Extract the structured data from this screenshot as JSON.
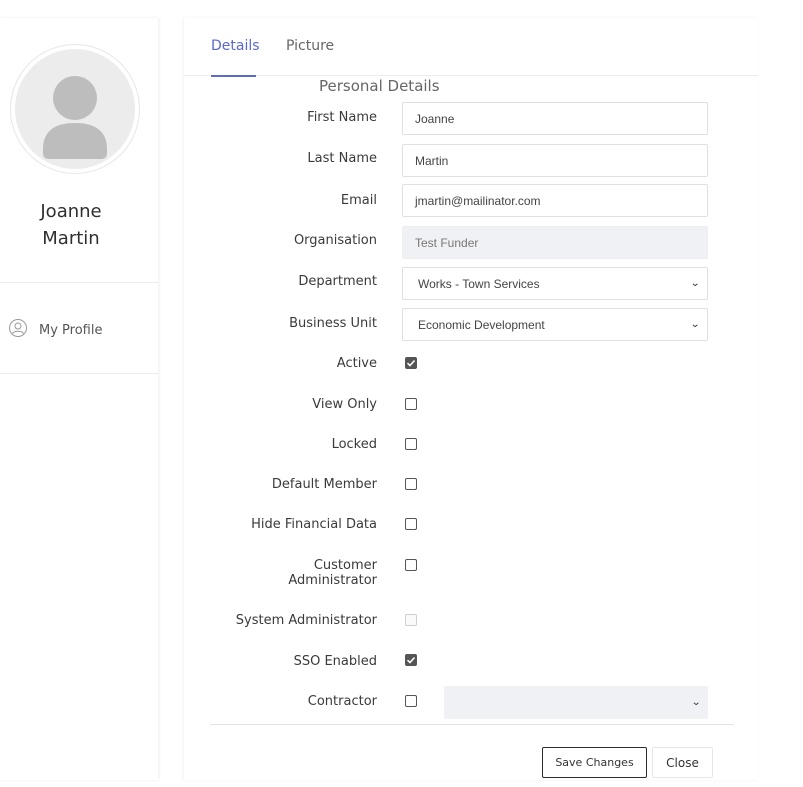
{
  "profile": {
    "name_line1": "Joanne",
    "name_line2": "Martin",
    "avatar_icon": "user-silhouette-icon",
    "menu": [
      {
        "label": "My Profile",
        "icon": "profile-icon"
      }
    ]
  },
  "tabs": [
    {
      "label": "Details",
      "active": true
    },
    {
      "label": "Picture",
      "active": false
    }
  ],
  "form": {
    "section_title": "Personal Details",
    "first_name": {
      "label": "First Name",
      "value": "Joanne"
    },
    "last_name": {
      "label": "Last Name",
      "value": "Martin"
    },
    "email": {
      "label": "Email",
      "value": "jmartin@mailinator.com"
    },
    "organisation": {
      "label": "Organisation",
      "value": "Test Funder"
    },
    "department": {
      "label": "Department",
      "value": "Works - Town Services"
    },
    "business_unit": {
      "label": "Business Unit",
      "value": "Economic Development"
    },
    "checkboxes": {
      "active": {
        "label": "Active",
        "checked": true
      },
      "view_only": {
        "label": "View Only",
        "checked": false
      },
      "locked": {
        "label": "Locked",
        "checked": false
      },
      "default_member": {
        "label": "Default Member",
        "checked": false
      },
      "hide_financial_data": {
        "label": "Hide Financial Data",
        "checked": false
      },
      "customer_administrator": {
        "label_line1": "Customer",
        "label_line2": "Administrator",
        "checked": false
      },
      "system_administrator": {
        "label": "System Administrator",
        "checked": false,
        "disabled": true
      },
      "sso_enabled": {
        "label": "SSO Enabled",
        "checked": true
      },
      "contractor": {
        "label": "Contractor",
        "checked": false,
        "select_value": ""
      }
    }
  },
  "actions": {
    "save_label": "Save Changes",
    "close_label": "Close"
  },
  "colors": {
    "accent": "#5a6acf",
    "readonly_bg": "#f0f1f4",
    "checkbox_checked": "#555555"
  }
}
